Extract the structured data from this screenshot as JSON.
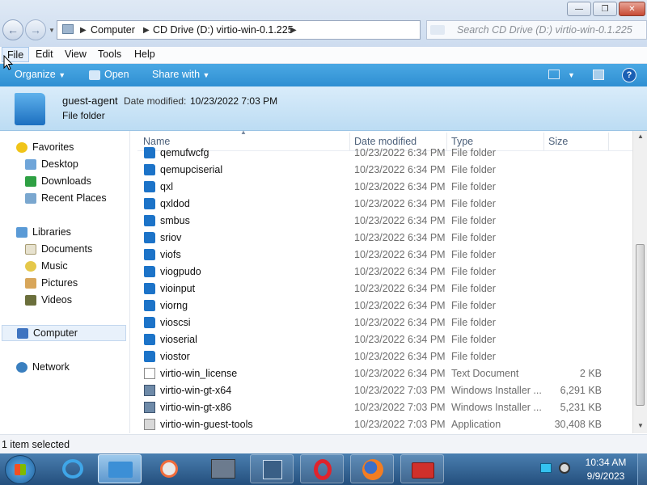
{
  "window": {
    "breadcrumbs": [
      "Computer",
      "CD Drive (D:) virtio-win-0.1.225"
    ],
    "search_placeholder": "Search CD Drive (D:) virtio-win-0.1.225"
  },
  "menu": [
    "File",
    "Edit",
    "View",
    "Tools",
    "Help"
  ],
  "toolbar": {
    "organize": "Organize",
    "open": "Open",
    "share_with": "Share with"
  },
  "details": {
    "name": "guest-agent",
    "date_modified_label": "Date modified:",
    "date_modified_value": "10/23/2022 7:03 PM",
    "type": "File folder"
  },
  "nav": {
    "favorites": "Favorites",
    "favorites_items": [
      "Desktop",
      "Downloads",
      "Recent Places"
    ],
    "libraries": "Libraries",
    "libraries_items": [
      "Documents",
      "Music",
      "Pictures",
      "Videos"
    ],
    "computer": "Computer",
    "network": "Network"
  },
  "columns": {
    "name": "Name",
    "date": "Date modified",
    "type": "Type",
    "size": "Size"
  },
  "files": [
    {
      "name": "qemufwcfg",
      "date": "10/23/2022 6:34 PM",
      "type": "File folder",
      "size": "",
      "icon": "folder"
    },
    {
      "name": "qemupciserial",
      "date": "10/23/2022 6:34 PM",
      "type": "File folder",
      "size": "",
      "icon": "folder"
    },
    {
      "name": "qxl",
      "date": "10/23/2022 6:34 PM",
      "type": "File folder",
      "size": "",
      "icon": "folder"
    },
    {
      "name": "qxldod",
      "date": "10/23/2022 6:34 PM",
      "type": "File folder",
      "size": "",
      "icon": "folder"
    },
    {
      "name": "smbus",
      "date": "10/23/2022 6:34 PM",
      "type": "File folder",
      "size": "",
      "icon": "folder"
    },
    {
      "name": "sriov",
      "date": "10/23/2022 6:34 PM",
      "type": "File folder",
      "size": "",
      "icon": "folder"
    },
    {
      "name": "viofs",
      "date": "10/23/2022 6:34 PM",
      "type": "File folder",
      "size": "",
      "icon": "folder"
    },
    {
      "name": "viogpudo",
      "date": "10/23/2022 6:34 PM",
      "type": "File folder",
      "size": "",
      "icon": "folder"
    },
    {
      "name": "vioinput",
      "date": "10/23/2022 6:34 PM",
      "type": "File folder",
      "size": "",
      "icon": "folder"
    },
    {
      "name": "viorng",
      "date": "10/23/2022 6:34 PM",
      "type": "File folder",
      "size": "",
      "icon": "folder"
    },
    {
      "name": "vioscsi",
      "date": "10/23/2022 6:34 PM",
      "type": "File folder",
      "size": "",
      "icon": "folder"
    },
    {
      "name": "vioserial",
      "date": "10/23/2022 6:34 PM",
      "type": "File folder",
      "size": "",
      "icon": "folder"
    },
    {
      "name": "viostor",
      "date": "10/23/2022 6:34 PM",
      "type": "File folder",
      "size": "",
      "icon": "folder"
    },
    {
      "name": "virtio-win_license",
      "date": "10/23/2022 6:34 PM",
      "type": "Text Document",
      "size": "2 KB",
      "icon": "doc"
    },
    {
      "name": "virtio-win-gt-x64",
      "date": "10/23/2022 7:03 PM",
      "type": "Windows Installer ...",
      "size": "6,291 KB",
      "icon": "msi"
    },
    {
      "name": "virtio-win-gt-x86",
      "date": "10/23/2022 7:03 PM",
      "type": "Windows Installer ...",
      "size": "5,231 KB",
      "icon": "msi"
    },
    {
      "name": "virtio-win-guest-tools",
      "date": "10/23/2022 7:03 PM",
      "type": "Application",
      "size": "30,408 KB",
      "icon": "app"
    }
  ],
  "status": "1 item selected",
  "clock": {
    "time": "10:34 AM",
    "date": "9/9/2023"
  },
  "colors": {
    "command_bar": "#2f8fd2",
    "taskbar": "#244f7d",
    "folder": "#1c73c8"
  }
}
